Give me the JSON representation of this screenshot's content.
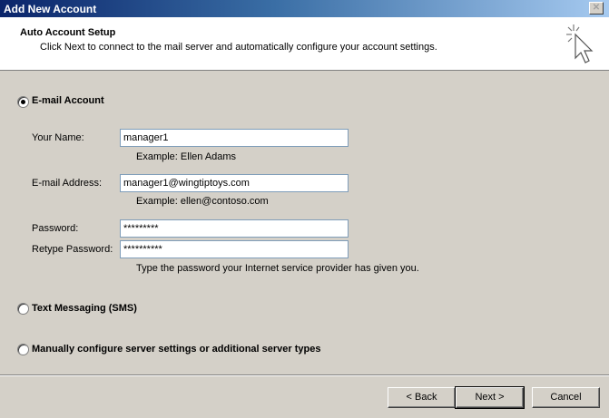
{
  "window": {
    "title": "Add New Account",
    "close_glyph": "✕"
  },
  "header": {
    "title": "Auto Account Setup",
    "subtitle": "Click Next to connect to the mail server and automatically configure your account settings."
  },
  "options": {
    "email_account": "E-mail Account",
    "sms": "Text Messaging (SMS)",
    "manual": "Manually configure server settings or additional server types"
  },
  "form": {
    "name_label": "Your Name:",
    "name_value": "manager1",
    "name_hint": "Example: Ellen Adams",
    "email_label": "E-mail Address:",
    "email_value": "manager1@wingtiptoys.com",
    "email_hint": "Example: ellen@contoso.com",
    "password_label": "Password:",
    "password_value": "*********",
    "retype_label": "Retype Password:",
    "retype_value": "**********",
    "password_hint": "Type the password your Internet service provider has given you."
  },
  "buttons": {
    "back": "< Back",
    "next": "Next >",
    "cancel": "Cancel"
  },
  "colors": {
    "titlebar_start": "#0a246a",
    "dialog_bg": "#d4d0c8",
    "input_border": "#7f9db9"
  }
}
